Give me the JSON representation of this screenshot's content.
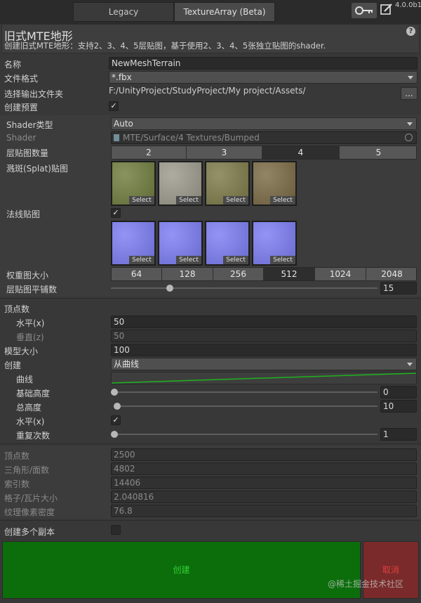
{
  "tabs": [
    "Legacy",
    "TextureArray (Beta)"
  ],
  "version": "4.0.0b1",
  "header": {
    "title": "旧式MTE地形",
    "desc": "创建旧式MTE地形：支持2、3、4、5层贴图，基于使用2、3、4、5张独立贴图的shader.",
    "help": "?"
  },
  "form": {
    "name_label": "名称",
    "name_value": "NewMeshTerrain",
    "format_label": "文件格式",
    "format_value": "*.fbx",
    "output_label": "选择输出文件夹",
    "output_value": "F:/UnityProject/StudyProject/My project/Assets/",
    "browse": "...",
    "prefab_label": "创建预置",
    "prefab_check": "✓"
  },
  "shader": {
    "type_label": "Shader类型",
    "type_value": "Auto",
    "shader_label": "Shader",
    "shader_value": "MTE/Surface/4 Textures/Bumped",
    "layers_label": "层贴图数量",
    "layers": [
      "2",
      "3",
      "4",
      "5"
    ],
    "splat_label": "溅斑(Splat)贴图",
    "normal_label": "法线贴图",
    "normal_check": "✓",
    "select": "Select",
    "splat_colors": [
      "#6f7c3d",
      "#9c9a8c",
      "#7d7a48",
      "#7a6a44"
    ],
    "normal_color": "#7b7cf2",
    "weight_label": "权重图大小",
    "weights": [
      "64",
      "128",
      "256",
      "512",
      "1024",
      "2048"
    ],
    "tiling_label": "层贴图平铺数",
    "tiling_value": "15",
    "tiling_fraction": 0.22
  },
  "mesh": {
    "vertex_label": "顶点数",
    "horizontal_label": "水平(x)",
    "horizontal_value": "50",
    "vertical_label": "垂直(z)",
    "vertical_value": "50",
    "size_label": "模型大小",
    "size_value": "100",
    "create_label": "创建",
    "create_value": "从曲线",
    "curve_label": "曲线",
    "curve_color": "#1fb31f",
    "base_label": "基础高度",
    "base_value": "0",
    "total_label": "总高度",
    "total_value": "10",
    "horiz2_label": "水平(x)",
    "horiz2_check": "✓",
    "repeat_label": "重复次数",
    "repeat_value": "1"
  },
  "stats": {
    "vertices_label": "顶点数",
    "vertices_value": "2500",
    "tris_label": "三角形/面数",
    "tris_value": "4802",
    "index_label": "索引数",
    "index_value": "14406",
    "grid_label": "格子/瓦片大小",
    "grid_value": "2.040816",
    "density_label": "纹理像素密度",
    "density_value": "76.8"
  },
  "copies_label": "创建多个副本",
  "buttons": {
    "create": "创建",
    "cancel": "取消",
    "create_color": "#0b6e0b",
    "cancel_color": "#7a2a2a"
  },
  "watermark": "@稀土掘金技术社区"
}
